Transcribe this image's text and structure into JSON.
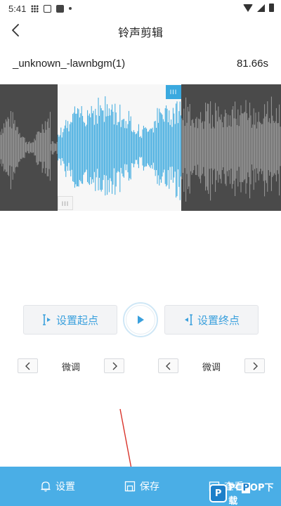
{
  "status_bar": {
    "time": "5:41"
  },
  "header": {
    "title": "铃声剪辑"
  },
  "file": {
    "name": "_unknown_-lawnbgm(1)",
    "duration": "81.66s"
  },
  "waveform": {
    "selection_start_fraction": 0.205,
    "selection_end_fraction": 0.645,
    "handle_glyph": "III",
    "colors": {
      "selected": "#3aa9df",
      "unselected": "#9a9a9a",
      "unselected_bg": "#4a4a4a",
      "selected_bg": "#f7f7f7"
    }
  },
  "controls": {
    "set_start_label": "设置起点",
    "set_end_label": "设置终点",
    "play_icon": "play-icon"
  },
  "fine_tune": {
    "left_label": "微调",
    "right_label": "微调",
    "prev_glyph": "<",
    "next_glyph": ">"
  },
  "bottom_bar": {
    "settings_label": "设置",
    "save_label": "保存",
    "view_label": "查看"
  },
  "watermark": {
    "badge": "P",
    "text_a": "PC",
    "text_b": "P",
    "text_c": "OP下载"
  },
  "colors": {
    "accent": "#4aaee6",
    "annotation": "#d9342b"
  }
}
